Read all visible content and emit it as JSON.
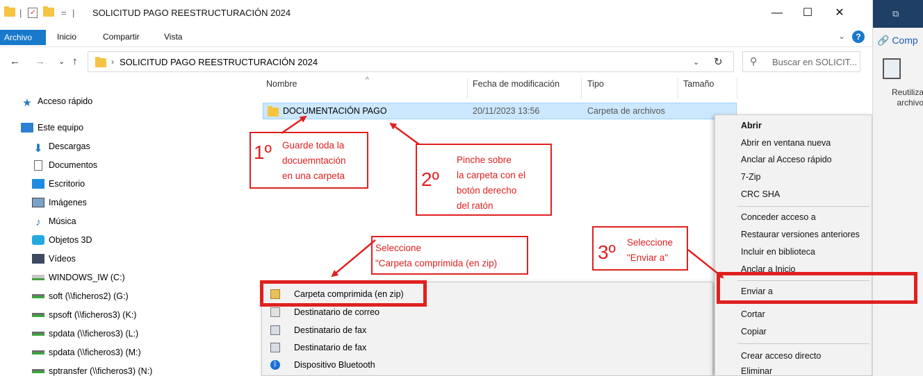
{
  "window": {
    "title": "SOLICITUD PAGO REESTRUCTURACIÓN 2024",
    "quick_access_sep": "=",
    "controls": {
      "minimize": "—",
      "maximize": "☐",
      "close": "✕"
    }
  },
  "ribbon": {
    "tabs": [
      "Archivo",
      "Inicio",
      "Compartir",
      "Vista"
    ],
    "help": "?",
    "expand": "⌄"
  },
  "address": {
    "back": "←",
    "forward": "→",
    "recent": "⌄",
    "up": "↑",
    "crumb_sep": "›",
    "path": "SOLICITUD PAGO REESTRUCTURACIÓN 2024",
    "dropdown": "⌄",
    "refresh": "↻",
    "search_icon": "⚲",
    "search_placeholder": "Buscar en SOLICIT..."
  },
  "right_strip": {
    "top_icon": "⧉",
    "compartir": "🔗 Comp",
    "reutiliza": "Reutiliza archivo"
  },
  "navpane": {
    "items": [
      {
        "label": "Acceso rápido",
        "icon": "star-icon"
      },
      {
        "label": "Este equipo",
        "icon": "pc-icon"
      },
      {
        "label": "Descargas",
        "icon": "download-icon"
      },
      {
        "label": "Documentos",
        "icon": "document-icon"
      },
      {
        "label": "Escritorio",
        "icon": "desktop-icon"
      },
      {
        "label": "Imágenes",
        "icon": "image-icon"
      },
      {
        "label": "Música",
        "icon": "music-icon"
      },
      {
        "label": "Objetos 3D",
        "icon": "cube-icon"
      },
      {
        "label": "Vídeos",
        "icon": "video-icon"
      },
      {
        "label": "WINDOWS_IW (C:)",
        "icon": "drive-icon"
      },
      {
        "label": "soft (\\\\ficheros2) (G:)",
        "icon": "network-drive-icon"
      },
      {
        "label": "spsoft (\\\\ficheros3) (K:)",
        "icon": "network-drive-icon"
      },
      {
        "label": "spdata (\\\\ficheros3) (L:)",
        "icon": "network-drive-icon"
      },
      {
        "label": "spdata (\\\\ficheros3) (M:)",
        "icon": "network-drive-icon"
      },
      {
        "label": "sptransfer (\\\\ficheros3) (N:)",
        "icon": "network-drive-icon"
      }
    ]
  },
  "filelist": {
    "columns": [
      "Nombre",
      "Fecha de modificación",
      "Tipo",
      "Tamaño"
    ],
    "sort_indicator": "^",
    "rows": [
      {
        "name": "DOCUMENTACIÓN PAGO",
        "date": "20/11/2023 13:56",
        "type": "Carpeta de archivos",
        "size": ""
      }
    ]
  },
  "context_menu": {
    "items": [
      "Abrir",
      "Abrir en ventana nueva",
      "Anclar al Acceso rápido",
      "7-Zip",
      "CRC SHA",
      "Conceder acceso a",
      "Restaurar versiones anteriores",
      "Incluir en biblioteca",
      "Anclar a Inicio",
      "Enviar a",
      "Cortar",
      "Copiar",
      "Crear acceso directo",
      "Eliminar"
    ],
    "submenu_arrow": "›"
  },
  "sendto_menu": {
    "items": [
      {
        "label": "Carpeta comprimida (en zip)",
        "icon": "zip-folder-icon"
      },
      {
        "label": "Destinatario de correo",
        "icon": "mail-icon"
      },
      {
        "label": "Destinatario de fax",
        "icon": "fax-icon"
      },
      {
        "label": "Destinatario de fax",
        "icon": "fax-icon"
      },
      {
        "label": "Dispositivo Bluetooth",
        "icon": "bluetooth-icon"
      }
    ]
  },
  "annotations": {
    "step1": {
      "num": "1º",
      "text": [
        "Guarde toda la",
        "docuemntación",
        "en una carpeta"
      ]
    },
    "step2": {
      "num": "2º",
      "text": [
        "Pinche sobre",
        "la carpeta con el",
        "botón derecho",
        "del ratón"
      ]
    },
    "step3": {
      "num": "3º",
      "text": [
        "Seleccione",
        "\"Enviar a\""
      ]
    },
    "step4": {
      "text": [
        "Seleccione",
        "\"Carpeta comprimida (en zip)"
      ]
    },
    "color": "#e02020"
  }
}
